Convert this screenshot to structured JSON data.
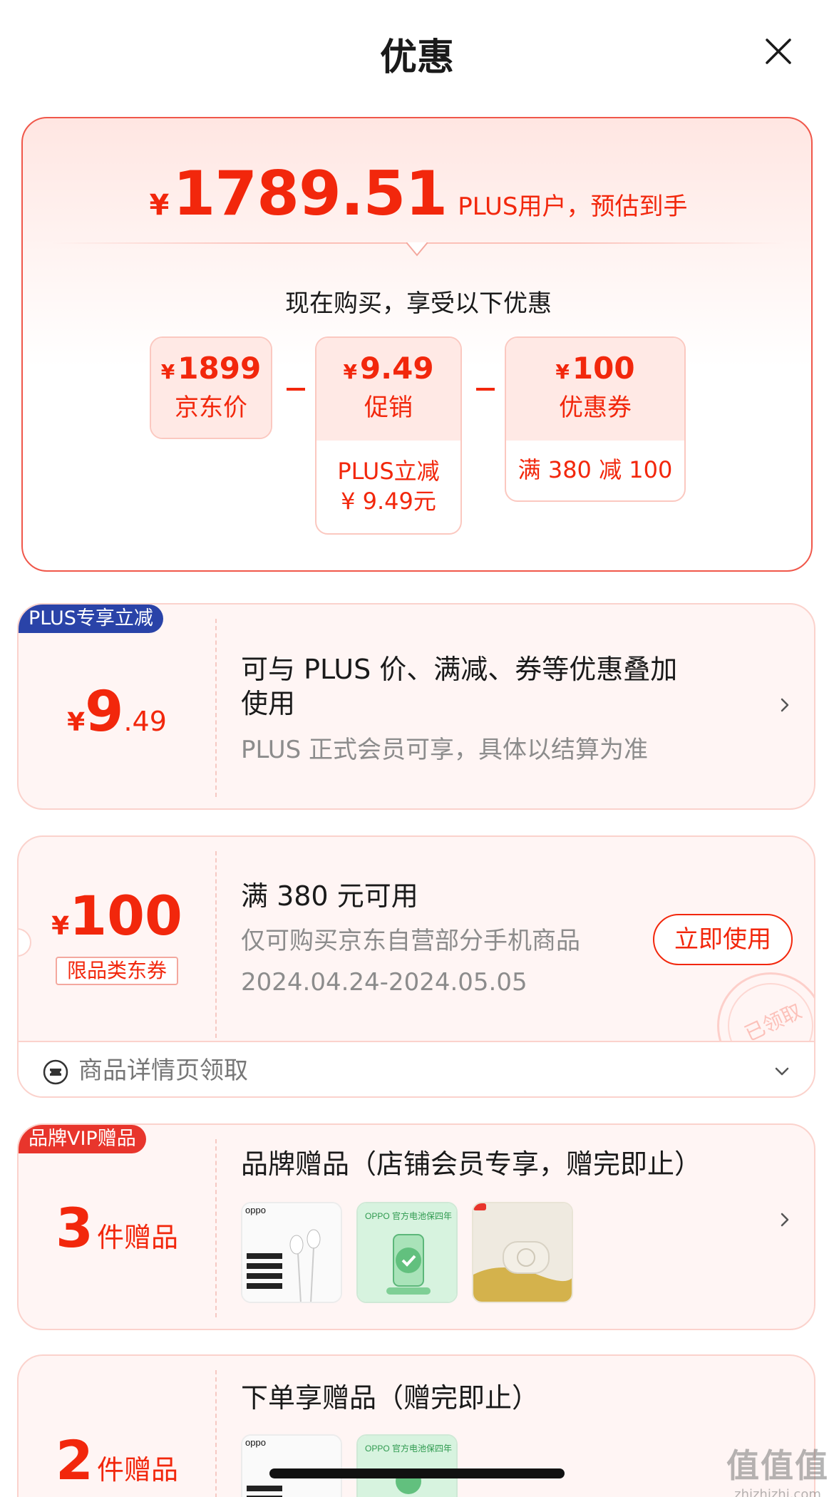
{
  "header": {
    "title": "优惠"
  },
  "summary": {
    "currency": "¥",
    "final_price": "1789.51",
    "price_note": "PLUS用户，预估到手",
    "subtitle": "现在购买，享受以下优惠",
    "breakdown": [
      {
        "amount": "1899",
        "label": "京东价",
        "detail": ""
      },
      {
        "amount": "9.49",
        "label": "促销",
        "detail_line1": "PLUS立减",
        "detail_line2": "¥ 9.49元"
      },
      {
        "amount": "100",
        "label": "优惠券",
        "detail_line1": "满 380 减 100"
      }
    ]
  },
  "offers": {
    "plus": {
      "tag": "PLUS专享立减",
      "currency": "¥",
      "int": "9",
      "dec": ".49",
      "line1": "可与 PLUS 价、满减、券等优惠叠加",
      "line2": "使用",
      "sub": "PLUS 正式会员可享，具体以结算为准"
    },
    "coupon": {
      "currency": "¥",
      "amount": "100",
      "badge": "限品类东券",
      "title": "满 380 元可用",
      "desc": "仅可购买京东自营部分手机商品",
      "validity": "2024.04.24-2024.05.05",
      "button": "立即使用",
      "stamp": "已领取",
      "source": "商品详情页领取"
    },
    "brand_gift": {
      "tag": "品牌VIP赠品",
      "count": "3",
      "unit": "件赠品",
      "title": "品牌赠品（店铺会员专享，赠完即止）",
      "images": [
        "earphones",
        "battery-warranty-card",
        "speaker"
      ]
    },
    "order_gift": {
      "count": "2",
      "unit": "件赠品",
      "title": "下单享赠品（赠完即止）"
    }
  },
  "watermark": {
    "line1": "值值值",
    "line2": "zhizhizhi.com"
  },
  "colors": {
    "accent": "#f2270c",
    "plus_blue": "#2a43a8",
    "card_bg": "#fff5f4"
  }
}
